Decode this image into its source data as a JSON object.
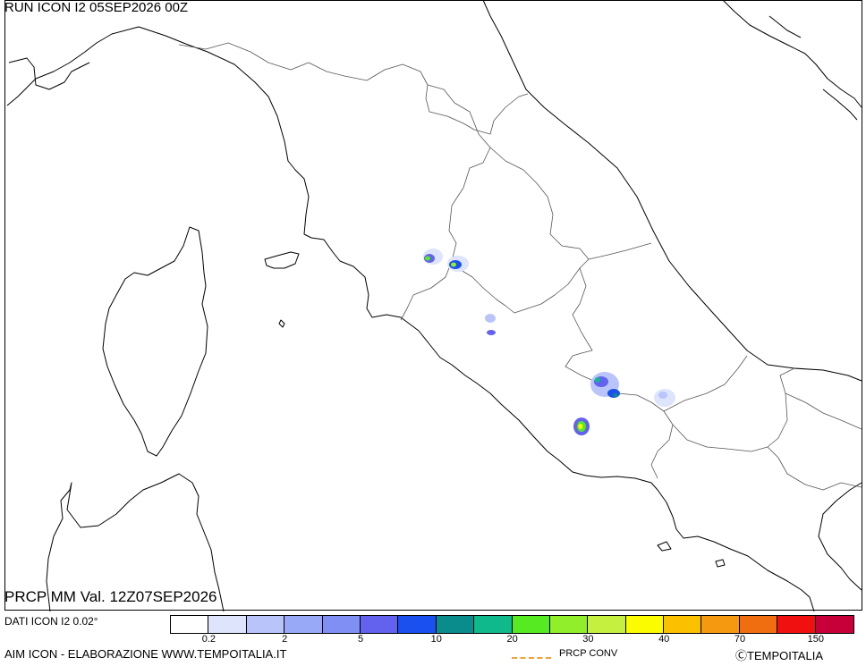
{
  "header": {
    "run_label": "RUN ICON I2 05SEP2026 00Z"
  },
  "footer": {
    "variable_label": "PRCP MM Val. 12Z07SEP2026",
    "data_source": "DATI ICON I2 0.02°",
    "producer": "AIM ICON - ELABORAZIONE WWW.TEMPOITALIA.IT",
    "conv_legend_label": "PRCP CONV",
    "copyright": "ⒸTEMPOITALIA"
  },
  "legend": {
    "colors": [
      "#ffffff",
      "#dde4fb",
      "#b9c5fa",
      "#98aaf7",
      "#7f8ff4",
      "#6262ee",
      "#1a4ff0",
      "#0a8c8c",
      "#0fb98c",
      "#55ea22",
      "#90ee2a",
      "#c6f040",
      "#fcfc00",
      "#fbc000",
      "#f59a10",
      "#f06e10",
      "#f01010",
      "#c8003a"
    ],
    "tick_labels": [
      "0.2",
      "2",
      "5",
      "10",
      "20",
      "30",
      "40",
      "70",
      "150"
    ],
    "conv_line_color": "#f0a040"
  },
  "precip_cells": [
    {
      "lon": 11.8,
      "lat": 42.55,
      "mm": 20
    },
    {
      "lon": 12.15,
      "lat": 42.52,
      "mm": 20
    },
    {
      "lon": 12.62,
      "lat": 42.1,
      "mm": 2
    },
    {
      "lon": 12.65,
      "lat": 41.95,
      "mm": 5
    },
    {
      "lon": 13.95,
      "lat": 41.7,
      "mm": 15
    },
    {
      "lon": 14.2,
      "lat": 41.6,
      "mm": 10
    },
    {
      "lon": 14.75,
      "lat": 41.6,
      "mm": 2
    },
    {
      "lon": 13.8,
      "lat": 41.2,
      "mm": 30
    }
  ]
}
